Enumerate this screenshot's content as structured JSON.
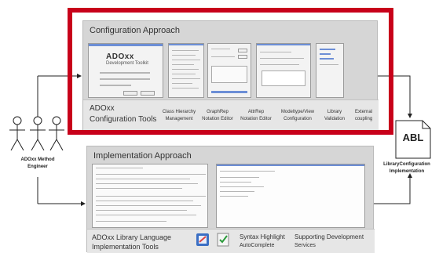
{
  "config": {
    "title": "Configuration Approach",
    "tools_title_line1": "ADOxx",
    "tools_title_line2": "Configuration Tools",
    "brand": "ADOxx",
    "brand_sub": "Development Toolkit",
    "tools": [
      {
        "line1": "Class Hierarchy",
        "line2": "Management"
      },
      {
        "line1": "GraphRep",
        "line2": "Notation Editor"
      },
      {
        "line1": "AttrRep",
        "line2": "Notation Editor"
      },
      {
        "line1": "Modeltype/View",
        "line2": "Configuration"
      },
      {
        "line1": "Library",
        "line2": "Validation"
      },
      {
        "line1": "External",
        "line2": "coupling"
      }
    ]
  },
  "implementation": {
    "title": "Implementation Approach",
    "tools_title_line1": "ADOxx Library Language",
    "tools_title_line2": "Implementation Tools",
    "syntax_line1": "Syntax Highlight",
    "syntax_line2": "AutoComplete",
    "support_line1": "Supporting Development",
    "support_line2": "Services"
  },
  "actor": {
    "line1": "ADOxx Method",
    "line2": "Engineer"
  },
  "abl": {
    "doc_label": "ABL",
    "line1": "LibraryConfiguration",
    "line2": "Implementation"
  }
}
